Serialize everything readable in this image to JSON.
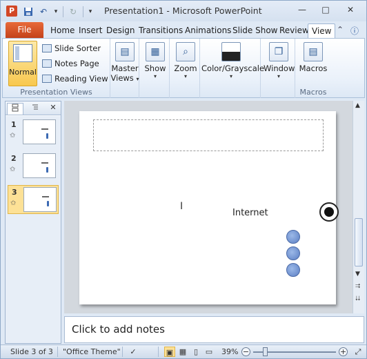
{
  "window": {
    "title": "Presentation1 - Microsoft PowerPoint",
    "app_icon": "P",
    "controls": {
      "minimize": "—",
      "maximize": "□",
      "close": "✕"
    }
  },
  "quick_access": {
    "save_icon": "💾",
    "undo_icon": "↶",
    "undo_dropdown": "▾",
    "redo_icon": "↻",
    "customize": "▾"
  },
  "tabs": {
    "file": "File",
    "items": [
      "Home",
      "Insert",
      "Design",
      "Transitions",
      "Animations",
      "Slide Show",
      "Review"
    ],
    "active": "View",
    "help": "ⓘ",
    "collapse": "⌃"
  },
  "ribbon": {
    "presentation_views": {
      "label": "Presentation Views",
      "normal": "Normal",
      "slide_sorter": "Slide Sorter",
      "notes_page": "Notes Page",
      "reading_view": "Reading View"
    },
    "master_views": {
      "line1": "Master",
      "line2": "Views"
    },
    "show": "Show",
    "zoom": "Zoom",
    "color_grayscale": "Color/Grayscale",
    "window": "Window",
    "macros": {
      "button": "Macros",
      "group_label": "Macros"
    },
    "dropdown_arrow": "▾"
  },
  "slides_pane": {
    "close": "✕",
    "slides": [
      {
        "number": "1",
        "star": "✩"
      },
      {
        "number": "2",
        "star": "✩"
      },
      {
        "number": "3",
        "star": "✩"
      }
    ],
    "selected": 3
  },
  "slide": {
    "text": "Internet",
    "ibeam": "I"
  },
  "scrollbar": {
    "up": "▲",
    "down": "▼",
    "prev": "⮆",
    "next": "⮇"
  },
  "notes": {
    "placeholder": "Click to add notes"
  },
  "status": {
    "slide_info": "Slide 3 of 3",
    "theme": "\"Office Theme\"",
    "zoom_level": "39%",
    "zoom_out": "−",
    "zoom_in": "+",
    "zoom_fraction": 0.39
  },
  "colors": {
    "file_tab": "#d24726",
    "selected": "#fde196",
    "accent": "#2b579a"
  }
}
